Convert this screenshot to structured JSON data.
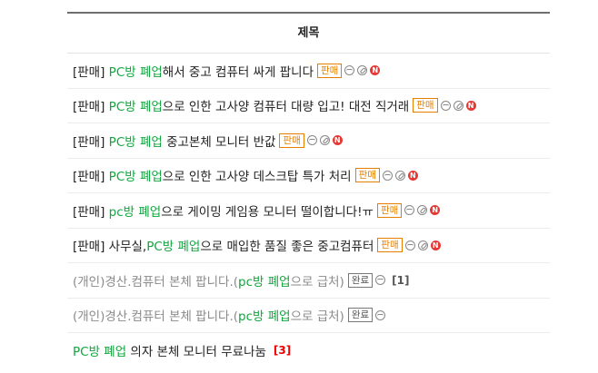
{
  "header": {
    "title": "제목"
  },
  "posts": [
    {
      "segments": [
        {
          "t": "[판매] ",
          "c": "n"
        },
        {
          "t": "PC방 폐업",
          "c": "g"
        },
        {
          "t": "해서 중고 컴퓨터 싸게 팝니다",
          "c": "n"
        }
      ],
      "tag": "판매",
      "tag_type": "sale",
      "image": true,
      "link": true,
      "new": true,
      "new_label": "N",
      "count": ""
    },
    {
      "segments": [
        {
          "t": "[판매] ",
          "c": "n"
        },
        {
          "t": "PC방 폐업",
          "c": "g"
        },
        {
          "t": "으로 인한 고사양 컴퓨터 대량 입고! 대전 직거래",
          "c": "n"
        }
      ],
      "tag": "판매",
      "tag_type": "sale",
      "image": true,
      "link": true,
      "new": true,
      "new_label": "N",
      "count": ""
    },
    {
      "segments": [
        {
          "t": "[판매] ",
          "c": "n"
        },
        {
          "t": "PC방 폐업",
          "c": "g"
        },
        {
          "t": " 중고본체 모니터 반값",
          "c": "n"
        }
      ],
      "tag": "판매",
      "tag_type": "sale",
      "image": true,
      "link": true,
      "new": true,
      "new_label": "N",
      "count": ""
    },
    {
      "segments": [
        {
          "t": "[판매] ",
          "c": "n"
        },
        {
          "t": "PC방 폐업",
          "c": "g"
        },
        {
          "t": "으로 인한 고사양 데스크탑 특가 처리",
          "c": "n"
        }
      ],
      "tag": "판매",
      "tag_type": "sale",
      "image": true,
      "link": true,
      "new": true,
      "new_label": "N",
      "count": ""
    },
    {
      "segments": [
        {
          "t": "[판매] ",
          "c": "n"
        },
        {
          "t": "pc방 폐업",
          "c": "g"
        },
        {
          "t": "으로 게이밍 게임용 모니터 떨이합니다!ㅠ",
          "c": "n"
        }
      ],
      "tag": "판매",
      "tag_type": "sale",
      "image": true,
      "link": true,
      "new": true,
      "new_label": "N",
      "count": ""
    },
    {
      "segments": [
        {
          "t": "[판매] 사무실,",
          "c": "n"
        },
        {
          "t": "PC방 폐업",
          "c": "g"
        },
        {
          "t": "으로 매입한 품질 좋은 중고컴퓨터",
          "c": "n"
        }
      ],
      "tag": "판매",
      "tag_type": "sale",
      "image": true,
      "link": true,
      "new": true,
      "new_label": "N",
      "count": ""
    },
    {
      "segments": [
        {
          "t": "(개인)경산.컴퓨터 본체 팝니다.(",
          "c": "x"
        },
        {
          "t": "pc방 폐업",
          "c": "g"
        },
        {
          "t": "으로 급처)",
          "c": "x"
        }
      ],
      "tag": "완료",
      "tag_type": "done",
      "image": true,
      "link": false,
      "new": false,
      "new_label": "",
      "count": "[1]"
    },
    {
      "segments": [
        {
          "t": "(개인)경산.컴퓨터 본체 팝니다.(",
          "c": "x"
        },
        {
          "t": "pc방 폐업",
          "c": "g"
        },
        {
          "t": "으로 급처)",
          "c": "x"
        }
      ],
      "tag": "완료",
      "tag_type": "done",
      "image": true,
      "link": false,
      "new": false,
      "new_label": "",
      "count": ""
    },
    {
      "segments": [
        {
          "t": "PC방 폐업",
          "c": "g"
        },
        {
          "t": " 의자 본체 모니터 무료나눔",
          "c": "n"
        }
      ],
      "tag": "",
      "tag_type": "",
      "image": false,
      "link": false,
      "new": false,
      "new_label": "",
      "count": "[3]"
    }
  ],
  "colors": {
    "accent_green": "#13a53f",
    "sale_orange": "#e67e00",
    "new_red": "#e53935"
  },
  "icons": {
    "image": "image-icon",
    "link": "link-icon",
    "new": "new-badge-icon"
  }
}
